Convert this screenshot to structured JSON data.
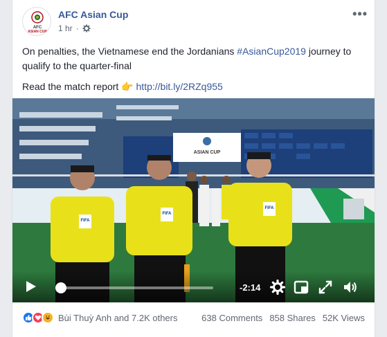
{
  "post": {
    "page_name": "AFC Asian Cup",
    "avatar_lines": [
      "AFC",
      "ASIAN CUP"
    ],
    "time": "1 hr",
    "more": "•••",
    "text_line1_pre": "On penalties, the Vietnamese end the Jordanians ",
    "hashtag": "#AsianCup2019",
    "text_line1_post": " journey to qualify to the quarter-final",
    "report_label": "Read the match report ",
    "report_emoji": "👉",
    "report_link": "http://bit.ly/2RZq955"
  },
  "video": {
    "time_remaining": "-2:14",
    "progress": 0.0,
    "board_label": "ASIAN CUP",
    "jersey_badge": "FIFA"
  },
  "footer": {
    "reaction_names": "Bùi Thuỳ Anh and 7.2K others",
    "comments": "638 Comments",
    "shares": "858 Shares",
    "views": "52K Views"
  },
  "colors": {
    "link": "#385898",
    "like": "#1877f2",
    "love": "#f33e58",
    "haha": "#f7b125",
    "referee_shirt": "#e8e11a"
  }
}
